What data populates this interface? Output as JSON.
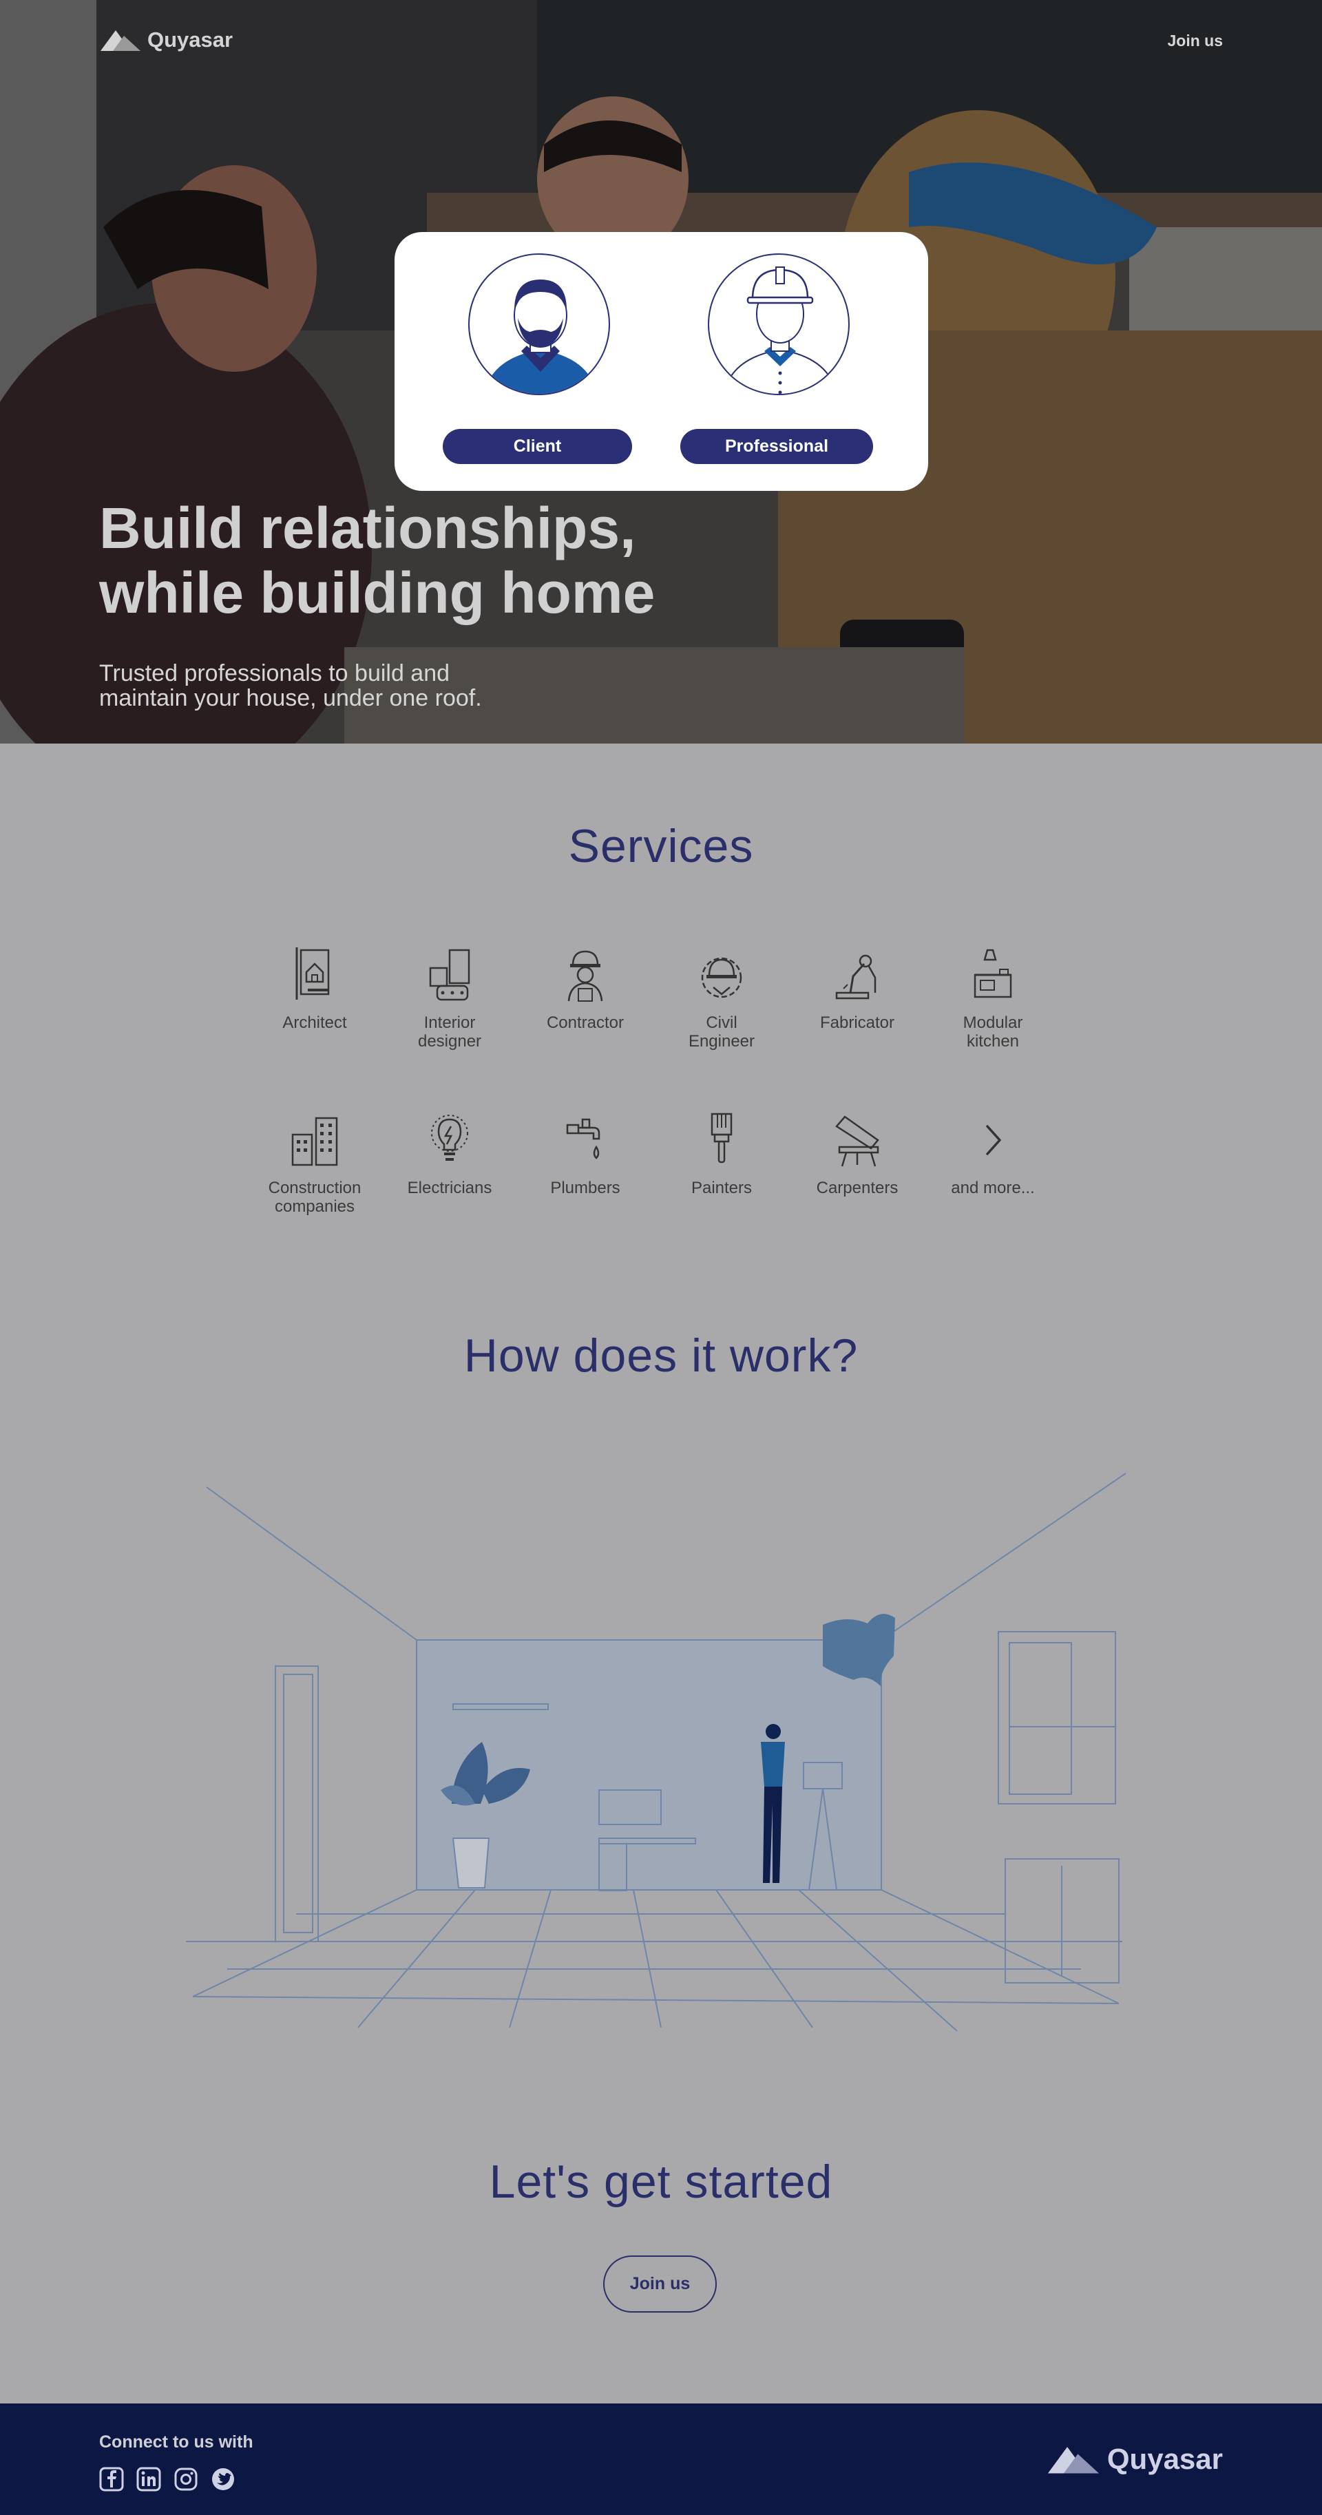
{
  "brand": {
    "name": "Quyasar"
  },
  "nav": {
    "join_label": "Join us"
  },
  "roles": {
    "client_label": "Client",
    "professional_label": "Professional"
  },
  "hero": {
    "title_line1": "Build relationships,",
    "title_line2": "while building home",
    "subtitle_line1": "Trusted professionals to build and",
    "subtitle_line2": "maintain your house, under one roof."
  },
  "services": {
    "title": "Services",
    "items": [
      {
        "label_1": "Architect",
        "label_2": "",
        "icon": "architect-icon"
      },
      {
        "label_1": "Interior",
        "label_2": "designer",
        "icon": "interior-designer-icon"
      },
      {
        "label_1": "Contractor",
        "label_2": "",
        "icon": "contractor-icon"
      },
      {
        "label_1": "Civil",
        "label_2": "Engineer",
        "icon": "civil-engineer-icon"
      },
      {
        "label_1": "Fabricator",
        "label_2": "",
        "icon": "fabricator-icon"
      },
      {
        "label_1": "Modular",
        "label_2": "kitchen",
        "icon": "modular-kitchen-icon"
      },
      {
        "label_1": "Construction",
        "label_2": "companies",
        "icon": "construction-companies-icon"
      },
      {
        "label_1": "Electricians",
        "label_2": "",
        "icon": "electricians-icon"
      },
      {
        "label_1": "Plumbers",
        "label_2": "",
        "icon": "plumbers-icon"
      },
      {
        "label_1": "Painters",
        "label_2": "",
        "icon": "painters-icon"
      },
      {
        "label_1": "Carpenters",
        "label_2": "",
        "icon": "carpenters-icon"
      },
      {
        "label_1": "and more...",
        "label_2": "",
        "icon": "chevron-right-icon"
      }
    ]
  },
  "how": {
    "title": "How does it work?"
  },
  "cta": {
    "title": "Let's get started",
    "button_label": "Join us"
  },
  "footer": {
    "connect_label": "Connect to us with",
    "socials": [
      "facebook-icon",
      "linkedin-icon",
      "instagram-icon",
      "twitter-icon"
    ]
  },
  "colors": {
    "navy": "#2b2f75",
    "footer_bg": "#0d1744",
    "page_bg": "#a9a9ab"
  }
}
